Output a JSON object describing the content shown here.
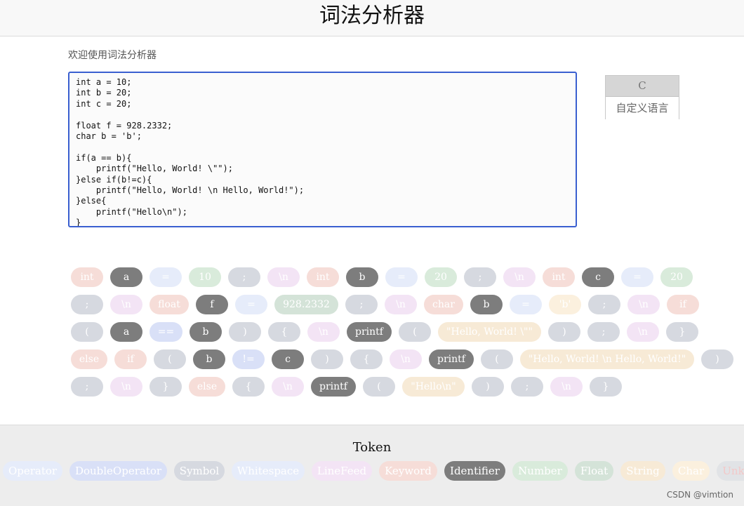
{
  "header": {
    "title": "词法分析器"
  },
  "welcome": "欢迎使用词法分析器",
  "editor": {
    "code": "int a = 10;\nint b = 20;\nint c = 20;\n\nfloat f = 928.2332;\nchar b = 'b';\n\nif(a == b){\n    printf(\"Hello, World! \\\"\");\n}else if(b!=c){\n    printf(\"Hello, World! \\n Hello, World!\");\n}else{\n    printf(\"Hello\\n\");\n}"
  },
  "languages": {
    "c": "C",
    "custom": "自定义语言"
  },
  "token_rows": [
    [
      {
        "text": "int",
        "type": "keyword"
      },
      {
        "text": "a",
        "type": "identifier"
      },
      {
        "text": "=",
        "type": "operator"
      },
      {
        "text": "10",
        "type": "number"
      },
      {
        "text": ";",
        "type": "symbol"
      },
      {
        "text": "\\n",
        "type": "linefeed"
      },
      {
        "text": "int",
        "type": "keyword"
      },
      {
        "text": "b",
        "type": "identifier"
      },
      {
        "text": "=",
        "type": "operator"
      },
      {
        "text": "20",
        "type": "number"
      },
      {
        "text": ";",
        "type": "symbol"
      },
      {
        "text": "\\n",
        "type": "linefeed"
      },
      {
        "text": "int",
        "type": "keyword"
      },
      {
        "text": "c",
        "type": "identifier"
      },
      {
        "text": "=",
        "type": "operator"
      },
      {
        "text": "20",
        "type": "number"
      }
    ],
    [
      {
        "text": ";",
        "type": "symbol"
      },
      {
        "text": "\\n",
        "type": "linefeed"
      },
      {
        "text": "float",
        "type": "keyword"
      },
      {
        "text": "f",
        "type": "identifier"
      },
      {
        "text": "=",
        "type": "operator"
      },
      {
        "text": "928.2332",
        "type": "float"
      },
      {
        "text": ";",
        "type": "symbol"
      },
      {
        "text": "\\n",
        "type": "linefeed"
      },
      {
        "text": "char",
        "type": "keyword"
      },
      {
        "text": "b",
        "type": "identifier"
      },
      {
        "text": "=",
        "type": "operator"
      },
      {
        "text": "'b'",
        "type": "char"
      },
      {
        "text": ";",
        "type": "symbol"
      },
      {
        "text": "\\n",
        "type": "linefeed"
      },
      {
        "text": "if",
        "type": "keyword"
      }
    ],
    [
      {
        "text": "(",
        "type": "symbol"
      },
      {
        "text": "a",
        "type": "identifier"
      },
      {
        "text": "==",
        "type": "double"
      },
      {
        "text": "b",
        "type": "identifier"
      },
      {
        "text": ")",
        "type": "symbol"
      },
      {
        "text": "{",
        "type": "symbol"
      },
      {
        "text": "\\n",
        "type": "linefeed"
      },
      {
        "text": "printf",
        "type": "identifier"
      },
      {
        "text": "(",
        "type": "symbol"
      },
      {
        "text": "\"Hello, World! \\\"\"",
        "type": "string"
      },
      {
        "text": ")",
        "type": "symbol"
      },
      {
        "text": ";",
        "type": "symbol"
      },
      {
        "text": "\\n",
        "type": "linefeed"
      },
      {
        "text": "}",
        "type": "symbol"
      }
    ],
    [
      {
        "text": "else",
        "type": "keyword"
      },
      {
        "text": "if",
        "type": "keyword"
      },
      {
        "text": "(",
        "type": "symbol"
      },
      {
        "text": "b",
        "type": "identifier"
      },
      {
        "text": "!=",
        "type": "double"
      },
      {
        "text": "c",
        "type": "identifier"
      },
      {
        "text": ")",
        "type": "symbol"
      },
      {
        "text": "{",
        "type": "symbol"
      },
      {
        "text": "\\n",
        "type": "linefeed"
      },
      {
        "text": "printf",
        "type": "identifier"
      },
      {
        "text": "(",
        "type": "symbol"
      },
      {
        "text": "\"Hello, World! \\n Hello, World!\"",
        "type": "string"
      },
      {
        "text": ")",
        "type": "symbol"
      }
    ],
    [
      {
        "text": ";",
        "type": "symbol"
      },
      {
        "text": "\\n",
        "type": "linefeed"
      },
      {
        "text": "}",
        "type": "symbol"
      },
      {
        "text": "else",
        "type": "keyword"
      },
      {
        "text": "{",
        "type": "symbol"
      },
      {
        "text": "\\n",
        "type": "linefeed"
      },
      {
        "text": "printf",
        "type": "identifier"
      },
      {
        "text": "(",
        "type": "symbol"
      },
      {
        "text": "\"Hello\\n\"",
        "type": "string"
      },
      {
        "text": ")",
        "type": "symbol"
      },
      {
        "text": ";",
        "type": "symbol"
      },
      {
        "text": "\\n",
        "type": "linefeed"
      },
      {
        "text": "}",
        "type": "symbol"
      }
    ]
  ],
  "footer": {
    "title": "Token",
    "legend": [
      {
        "label": "Operator",
        "type": "operator"
      },
      {
        "label": "DoubleOperator",
        "type": "double"
      },
      {
        "label": "Symbol",
        "type": "symbol"
      },
      {
        "label": "Whitespace",
        "type": "whitespace"
      },
      {
        "label": "LineFeed",
        "type": "linefeed"
      },
      {
        "label": "Keyword",
        "type": "keyword"
      },
      {
        "label": "Identifier",
        "type": "identifier"
      },
      {
        "label": "Number",
        "type": "number"
      },
      {
        "label": "Float",
        "type": "float"
      },
      {
        "label": "String",
        "type": "string"
      },
      {
        "label": "Char",
        "type": "char"
      },
      {
        "label": "Unknown",
        "type": "unknown"
      }
    ]
  },
  "watermark": "CSDN @vimtion"
}
